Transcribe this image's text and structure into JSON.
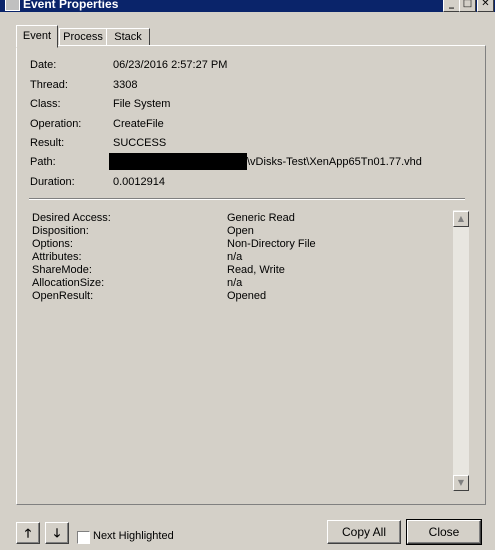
{
  "window": {
    "title": "Event Properties",
    "controls": {
      "minimize": "_",
      "maximize": "□",
      "close": "✕"
    }
  },
  "tabs": [
    {
      "label": "Event",
      "active": true
    },
    {
      "label": "Process",
      "active": false
    },
    {
      "label": "Stack",
      "active": false
    }
  ],
  "event": {
    "fields": [
      {
        "label": "Date:",
        "value": "06/23/2016 2:57:27 PM"
      },
      {
        "label": "Thread:",
        "value": "3308"
      },
      {
        "label": "Class:",
        "value": "File System"
      },
      {
        "label": "Operation:",
        "value": "CreateFile"
      },
      {
        "label": "Result:",
        "value": "SUCCESS"
      },
      {
        "label": "Path:",
        "value": "\\vDisks-Test\\XenApp65Tn01.77.vhd"
      },
      {
        "label": "Duration:",
        "value": "0.0012914"
      }
    ]
  },
  "details": [
    {
      "label": "Desired Access:",
      "value": "Generic Read"
    },
    {
      "label": "Disposition:",
      "value": "Open"
    },
    {
      "label": "Options:",
      "value": "Non-Directory File"
    },
    {
      "label": "Attributes:",
      "value": "n/a"
    },
    {
      "label": "ShareMode:",
      "value": "Read, Write"
    },
    {
      "label": "AllocationSize:",
      "value": "n/a"
    },
    {
      "label": "OpenResult:",
      "value": "Opened"
    }
  ],
  "footer": {
    "next_highlighted_label": "Next Highlighted",
    "next_highlighted_checked": false,
    "copy_all_label": "Copy All",
    "close_label": "Close"
  },
  "colors": {
    "titlebar": "#0a246a",
    "face": "#d4d0c8"
  }
}
